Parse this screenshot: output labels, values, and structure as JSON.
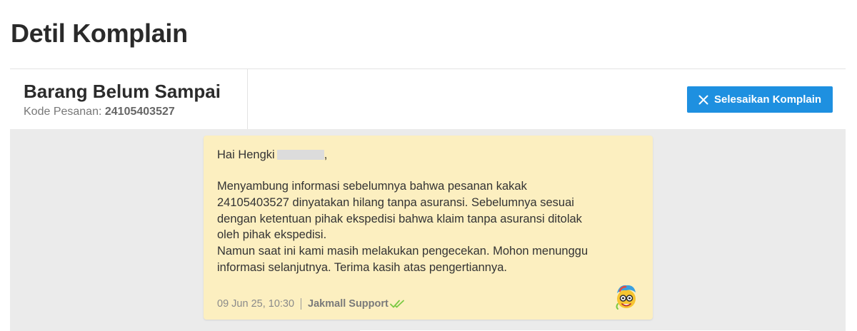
{
  "page": {
    "title": "Detil Komplain"
  },
  "complaint": {
    "title": "Barang Belum Sampai",
    "order_label": "Kode Pesanan:",
    "order_number": "24105403527",
    "finish_button_label": "Selesaikan Komplain"
  },
  "chat": {
    "message": {
      "greeting": "Hai Hengki",
      "greeting_suffix": ",",
      "body_lines": [
        "Menyambung informasi sebelumnya bahwa pesanan kakak",
        "24105403527 dinyatakan hilang tanpa asuransi. Sebelumnya sesuai",
        "dengan ketentuan pihak ekspedisi bahwa klaim tanpa asuransi ditolak",
        "oleh pihak ekspedisi.",
        "Namun saat ini kami masih melakukan pengecekan. Mohon menunggu",
        "informasi selanjutnya. Terima kasih atas pengertiannya."
      ],
      "timestamp": "09 Jun 25, 10:30",
      "sender": "Jakmall Support",
      "status_icon": "double-check-icon",
      "avatar_icon": "support-mascot-avatar"
    }
  },
  "colors": {
    "accent": "#1e90e0",
    "bubble": "#fcefc0",
    "chat_background": "#ebebeb",
    "read_check": "#7ac943"
  }
}
